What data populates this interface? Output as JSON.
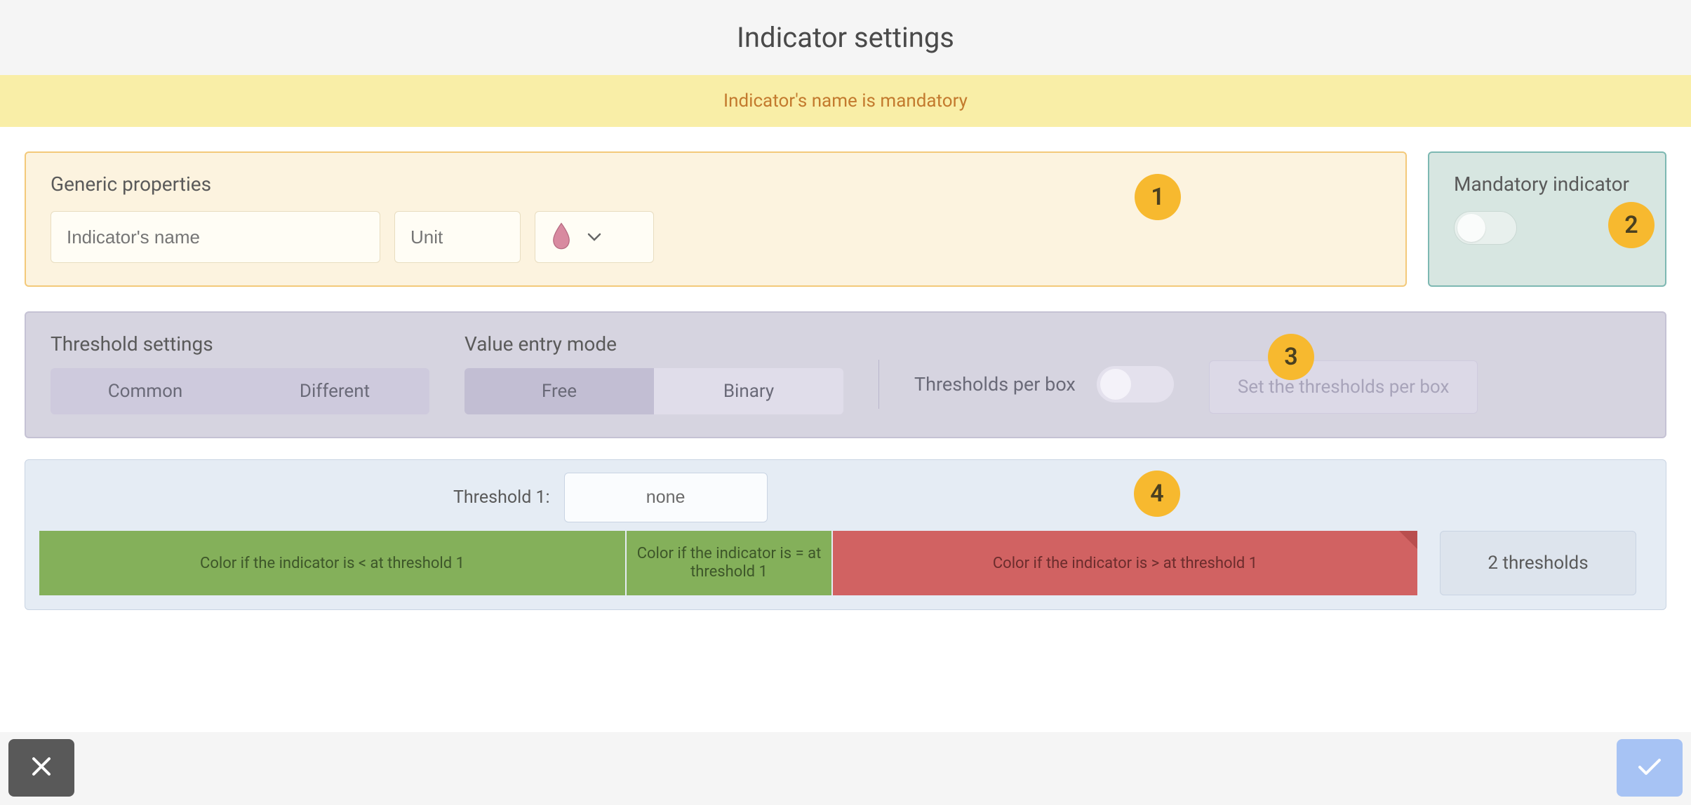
{
  "header": {
    "title": "Indicator settings"
  },
  "warning": "Indicator's name is mandatory",
  "generic": {
    "title": "Generic properties",
    "name_placeholder": "Indicator's name",
    "unit_placeholder": "Unit",
    "icon": "drop-icon"
  },
  "mandatory": {
    "title": "Mandatory indicator",
    "enabled": false
  },
  "threshold": {
    "title": "Threshold settings",
    "common_label": "Common",
    "different_label": "Different",
    "value_mode_title": "Value entry mode",
    "free_label": "Free",
    "binary_label": "Binary",
    "value_mode_selected": "Free",
    "per_box_label": "Thresholds per box",
    "per_box_enabled": false,
    "set_per_box_label": "Set the thresholds per box"
  },
  "colors": {
    "threshold1_label": "Threshold 1:",
    "threshold1_value": "none",
    "lt_label": "Color if the indicator is < at threshold 1",
    "eq_label": "Color if the indicator is = at threshold 1",
    "gt_label": "Color if the indicator is > at threshold 1",
    "two_thresholds_label": "2 thresholds",
    "lt_color": "#84b05a",
    "eq_color": "#84b05a",
    "gt_color": "#d16262"
  },
  "callouts": {
    "c1": "1",
    "c2": "2",
    "c3": "3",
    "c4": "4"
  }
}
